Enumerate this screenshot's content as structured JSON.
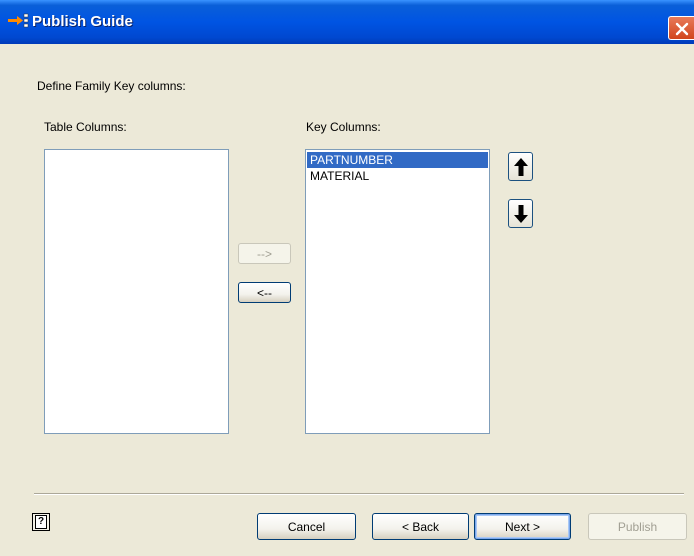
{
  "window": {
    "title": "Publish Guide",
    "close_icon": "close-icon",
    "title_icon": "publish-arrow-icon"
  },
  "instructions": "Define Family Key columns:",
  "table_columns": {
    "label": "Table Columns:",
    "items": []
  },
  "key_columns": {
    "label": "Key Columns:",
    "items": [
      {
        "text": "PARTNUMBER",
        "selected": true
      },
      {
        "text": "MATERIAL",
        "selected": false
      }
    ]
  },
  "transfer": {
    "add_label": "-->",
    "add_enabled": false,
    "remove_label": "<--",
    "remove_enabled": true
  },
  "reorder": {
    "up_icon": "arrow-up-icon",
    "down_icon": "arrow-down-icon"
  },
  "footer": {
    "help_icon": "help-icon",
    "cancel_label": "Cancel",
    "back_label": "< Back",
    "next_label": "Next >",
    "publish_label": "Publish",
    "publish_enabled": false
  },
  "colors": {
    "titlebar": "#0054e3",
    "selection": "#316ac5",
    "dialog_bg": "#ece9d8",
    "close_button": "#d2451c"
  }
}
